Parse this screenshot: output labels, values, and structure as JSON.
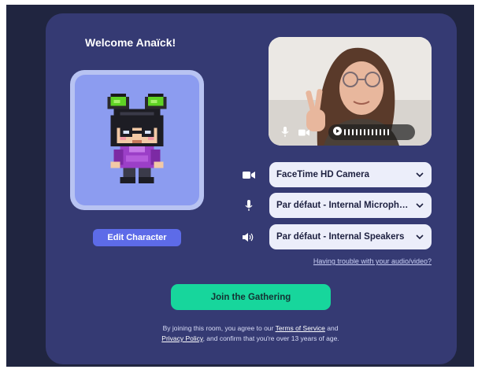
{
  "welcome": {
    "title": "Welcome Anaïck!"
  },
  "avatar": {
    "edit_label": "Edit Character"
  },
  "video": {
    "mic_icon": "microphone-icon",
    "cam_icon": "camera-icon",
    "play_icon": "play-icon"
  },
  "devices": [
    {
      "icon": "camera-icon",
      "selected": "FaceTime HD Camera"
    },
    {
      "icon": "microphone-icon",
      "selected": "Par défaut - Internal Microphone"
    },
    {
      "icon": "speaker-icon",
      "selected": "Par défaut - Internal Speakers"
    }
  ],
  "trouble_link": "Having trouble with your audio/video?",
  "join": {
    "label": "Join the Gathering"
  },
  "legal": {
    "prefix": "By joining this room, you agree to our ",
    "terms": "Terms of Service",
    "and": " and",
    "privacy": "Privacy Policy",
    "suffix": ", and confirm that you're over 13 years of age."
  },
  "colors": {
    "card": "#353a73",
    "join_button": "#17d69c",
    "edit_button": "#5d6be8",
    "avatar_bg": "#8c9cf0"
  }
}
